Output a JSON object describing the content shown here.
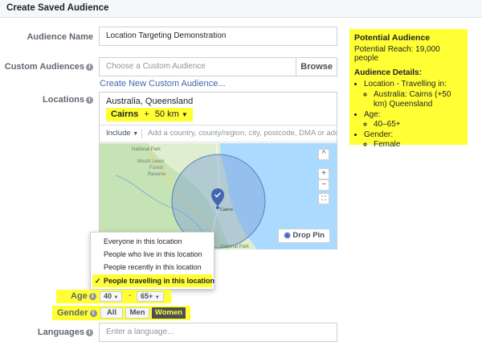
{
  "header": {
    "title": "Create Saved Audience"
  },
  "audience_name": {
    "label": "Audience Name",
    "value": "Location Targeting Demonstration"
  },
  "custom_audiences": {
    "label": "Custom Audiences",
    "placeholder": "Choose a Custom Audience",
    "browse_label": "Browse",
    "create_link": "Create New Custom Audience..."
  },
  "locations": {
    "label": "Locations",
    "country": "Australia, Queensland",
    "city": "Cairns",
    "radius_prefix": "+",
    "radius": "50 km",
    "include_label": "Include",
    "search_placeholder": "Add a country, county/region, city, postcode, DMA or address",
    "map": {
      "zoom_in": "+",
      "zoom_out": "−",
      "collapse": "^",
      "drop_pin_label": "Drop Pin",
      "place_labels": [
        "National Park",
        "Mount Lewis",
        "Forest",
        "Reserve",
        "Cairns",
        "National Park"
      ]
    }
  },
  "location_type_menu": {
    "items": [
      {
        "label": "Everyone in this location",
        "selected": false
      },
      {
        "label": "People who live in this location",
        "selected": false
      },
      {
        "label": "People recently in this location",
        "selected": false
      },
      {
        "label": "People travelling in this location",
        "selected": true
      }
    ],
    "check": "✓"
  },
  "age": {
    "label": "Age",
    "min": "40",
    "max": "65+",
    "separator": "-"
  },
  "gender": {
    "label": "Gender",
    "options": [
      "All",
      "Men",
      "Women"
    ],
    "selected": "Women"
  },
  "languages": {
    "label": "Languages",
    "placeholder": "Enter a language..."
  },
  "summary": {
    "title": "Potential Audience",
    "reach": "Potential Reach: 19,000 people",
    "details_title": "Audience Details:",
    "location_heading": "Location - Travelling in:",
    "location_value": "Australia: Cairns (+50 km) Queensland",
    "age_heading": "Age:",
    "age_value": "40–65+",
    "gender_heading": "Gender:",
    "gender_value": "Female"
  },
  "colors": {
    "highlight": "#ffff33",
    "link": "#4267b2",
    "radius_circle": "#7c9fd8",
    "pin": "#4267b2"
  }
}
